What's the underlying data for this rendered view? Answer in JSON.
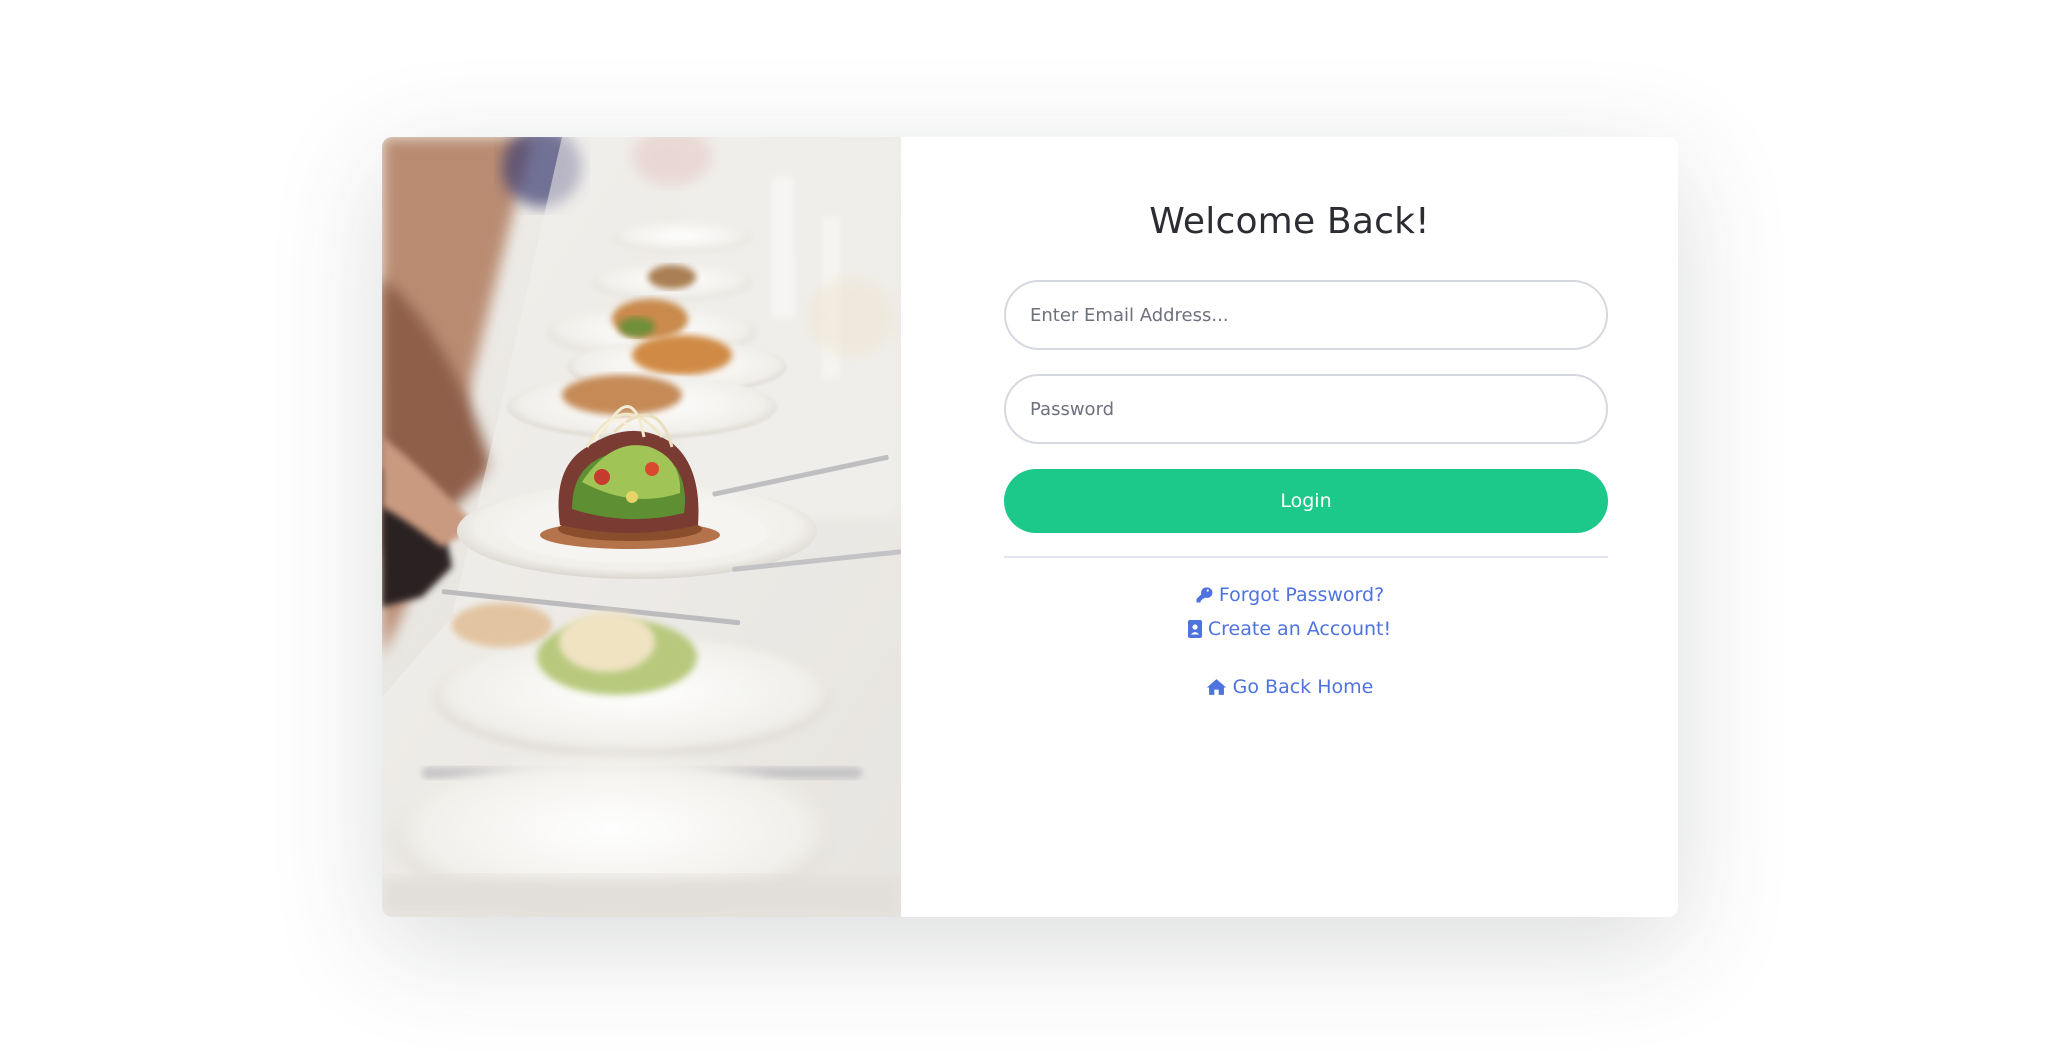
{
  "login": {
    "title": "Welcome Back!",
    "email_placeholder": "Enter Email Address...",
    "email_value": "",
    "password_placeholder": "Password",
    "password_value": "",
    "login_label": "Login",
    "forgot_label": "Forgot Password?",
    "create_label": "Create an Account!",
    "home_label": "Go Back Home"
  },
  "icons": {
    "forgot": "key-icon",
    "create": "address-book-icon",
    "home": "home-icon"
  },
  "colors": {
    "accent_button": "#1cc88a",
    "link": "#4e73df",
    "title_text": "#2b2d33",
    "field_border": "#d6d8e0"
  }
}
